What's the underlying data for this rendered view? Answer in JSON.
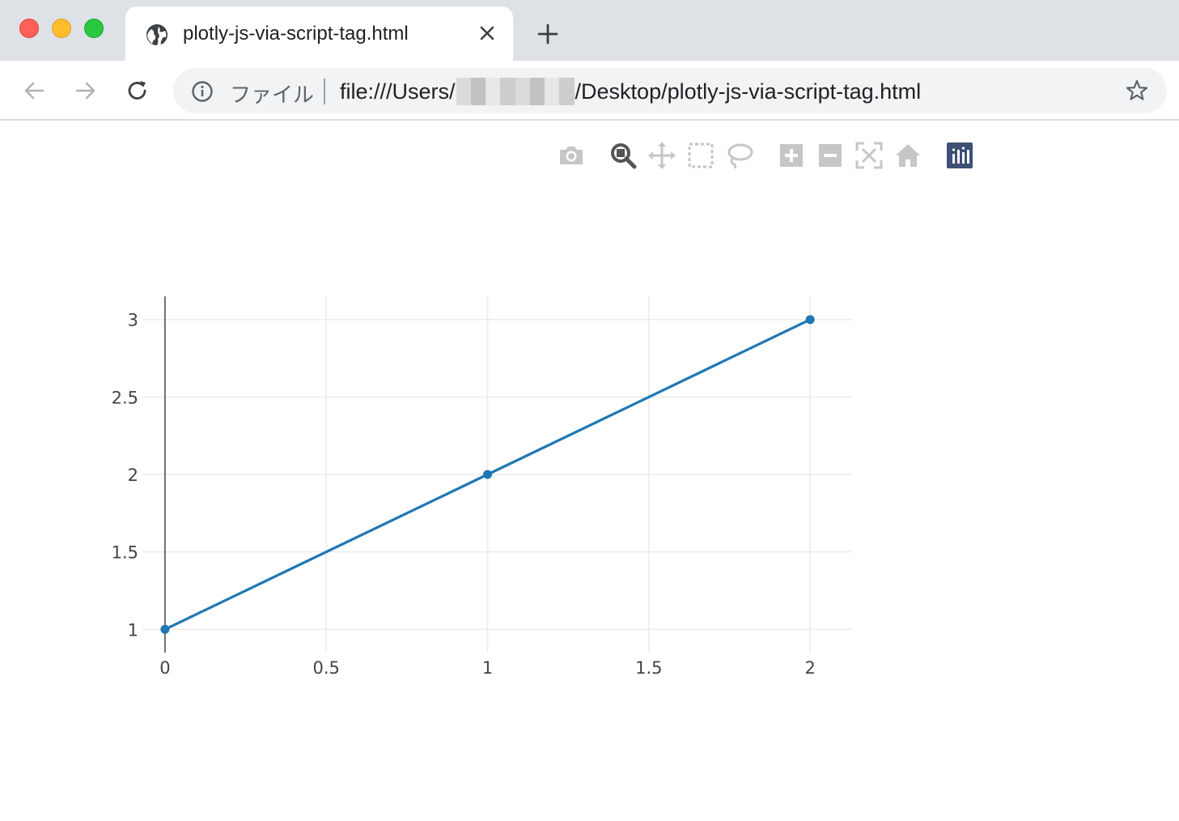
{
  "tab": {
    "title": "plotly-js-via-script-tag.html"
  },
  "address": {
    "scheme_label": "ファイル",
    "url_prefix": "file:///Users/",
    "url_suffix": "/Desktop/plotly-js-via-script-tag.html"
  },
  "colors": {
    "trace": "#1f77b4",
    "modebar_icon": "#c6c6c6",
    "modebar_active": "#555555",
    "plotly_logo": "#3f4f75"
  },
  "modebar": [
    "camera-icon",
    "zoom-icon",
    "pan-icon",
    "box-select-icon",
    "lasso-select-icon",
    "zoom-in-icon",
    "zoom-out-icon",
    "autoscale-icon",
    "reset-axes-icon",
    "plotly-logo-icon"
  ],
  "chart_data": {
    "type": "line",
    "mode": "lines+markers",
    "title": "",
    "xlabel": "",
    "ylabel": "",
    "x": [
      0,
      1,
      2
    ],
    "y": [
      1,
      2,
      3
    ],
    "xlim": [
      -0.07,
      2.13
    ],
    "ylim": [
      0.85,
      3.15
    ],
    "xticks": [
      0,
      0.5,
      1,
      1.5,
      2
    ],
    "xtick_labels": [
      "0",
      "0.5",
      "1",
      "1.5",
      "2"
    ],
    "yticks": [
      1,
      1.5,
      2,
      2.5,
      3
    ],
    "ytick_labels": [
      "1",
      "1.5",
      "2",
      "2.5",
      "3"
    ],
    "grid": true,
    "zeroline": "x=0"
  }
}
